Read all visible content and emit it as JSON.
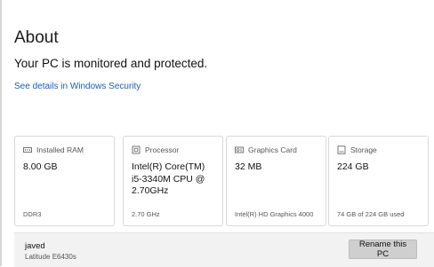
{
  "page": {
    "title": "About",
    "status": "Your PC is monitored and protected.",
    "security_link": "See details in Windows Security"
  },
  "cards": [
    {
      "label": "Installed RAM",
      "value": "8.00 GB",
      "foot": "DDR3",
      "icon": "ram-icon"
    },
    {
      "label": "Processor",
      "value": "Intel(R) Core(TM) i5-3340M CPU @ 2.70GHz",
      "foot": "2.70 GHz",
      "icon": "processor-icon"
    },
    {
      "label": "Graphics Card",
      "value": "32 MB",
      "foot": "Intel(R) HD Graphics 4000",
      "icon": "graphics-card-icon"
    },
    {
      "label": "Storage",
      "value": "224 GB",
      "foot": "74 GB of 224 GB used",
      "icon": "storage-icon"
    }
  ],
  "device": {
    "name": "javed",
    "model": "Latitude E6430s",
    "rename_label": "Rename this PC"
  },
  "colors": {
    "link": "#1a5fb4",
    "card_border": "#d9d9d9",
    "footer_bg": "#f2f2f2",
    "button_bg": "#cfcfcf"
  }
}
